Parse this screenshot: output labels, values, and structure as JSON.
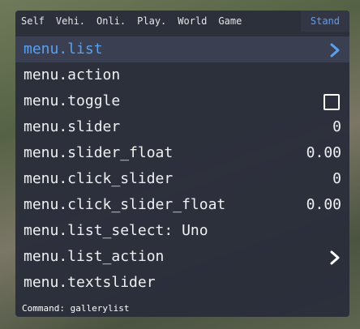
{
  "tabs": [
    "Self",
    "Vehi.",
    "Onli.",
    "Play.",
    "World",
    "Game",
    "Stand"
  ],
  "active_tab": "Stand",
  "items": [
    {
      "label": "menu.list",
      "type": "list"
    },
    {
      "label": "menu.action",
      "type": "action"
    },
    {
      "label": "menu.toggle",
      "type": "toggle",
      "checked": false
    },
    {
      "label": "menu.slider",
      "type": "slider",
      "value": "0"
    },
    {
      "label": "menu.slider_float",
      "type": "slider",
      "value": "0.00"
    },
    {
      "label": "menu.click_slider",
      "type": "slider",
      "value": "0"
    },
    {
      "label": "menu.click_slider_float",
      "type": "slider",
      "value": "0.00"
    },
    {
      "label": "menu.list_select: Uno",
      "type": "list_select"
    },
    {
      "label": "menu.list_action",
      "type": "list"
    },
    {
      "label": "menu.textslider",
      "type": "textslider"
    }
  ],
  "command": "Command: gallerylist",
  "colors": {
    "accent": "#5aa0ee",
    "panel": "#2a2e3a",
    "text": "#eef0f2"
  }
}
